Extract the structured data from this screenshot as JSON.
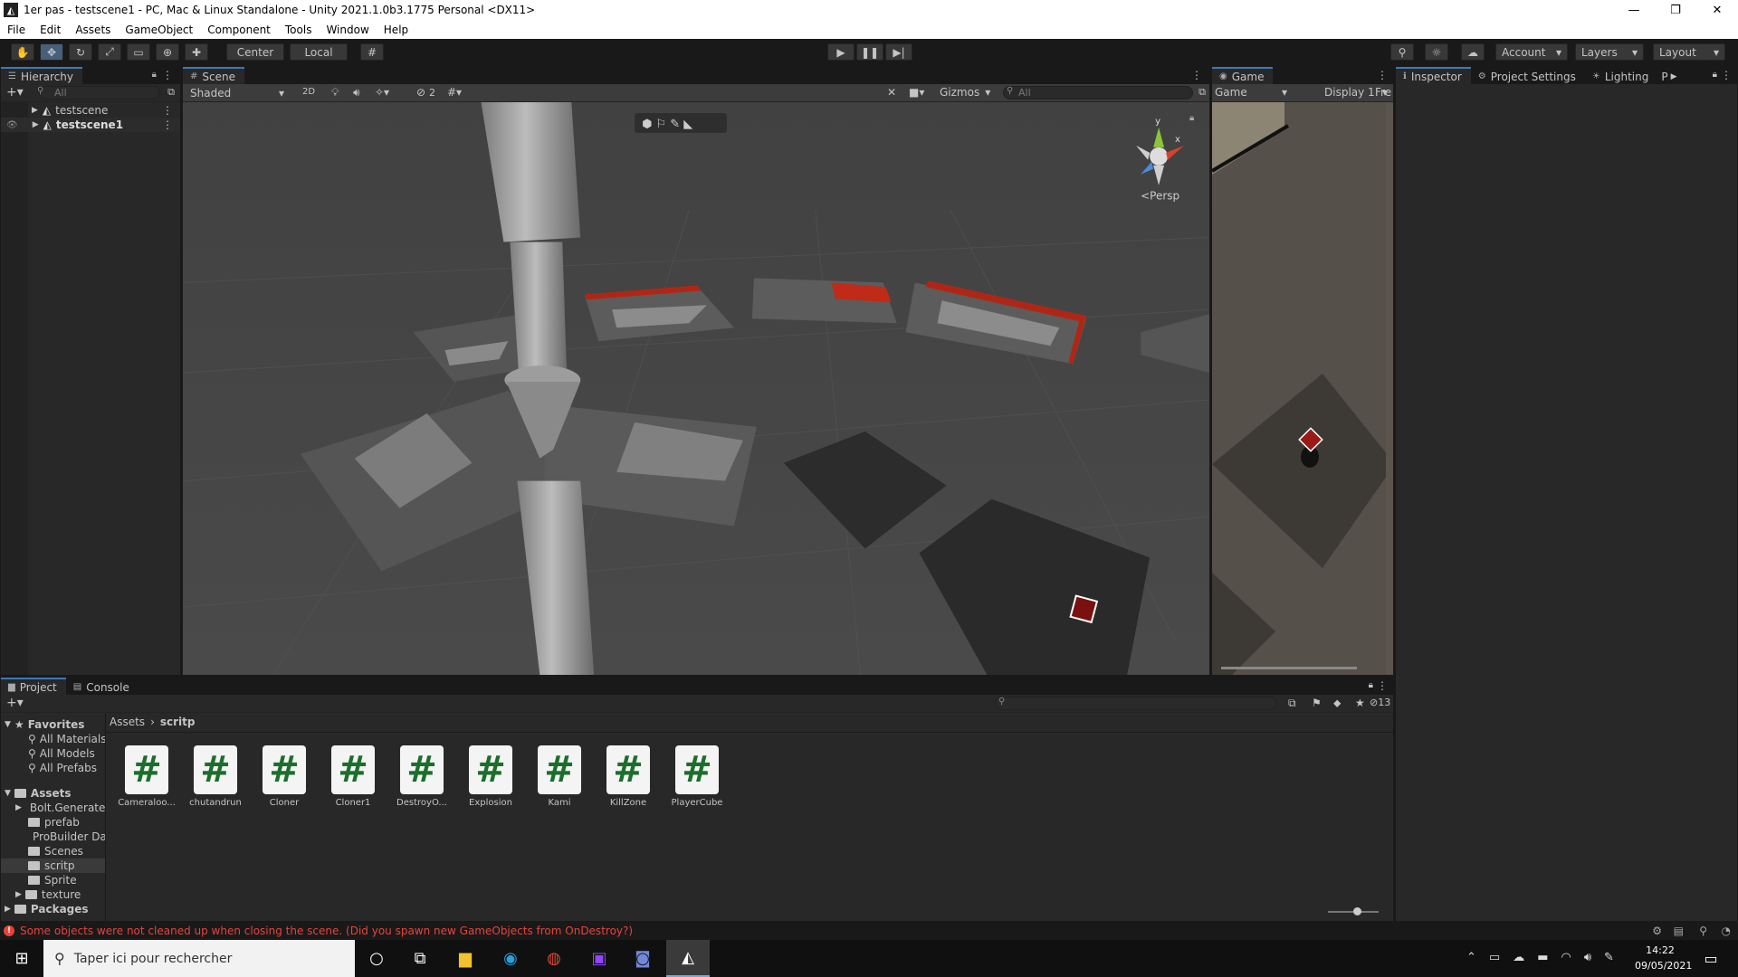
{
  "window": {
    "title": "1er pas - testscene1 - PC, Mac & Linux Standalone - Unity 2021.1.0b3.1775 Personal <DX11>",
    "controls": [
      "—",
      "❐",
      "✕"
    ]
  },
  "menu": [
    "File",
    "Edit",
    "Assets",
    "GameObject",
    "Component",
    "Tools",
    "Window",
    "Help"
  ],
  "toolbar": {
    "pivot": "Center",
    "space": "Local",
    "account": "Account",
    "layers": "Layers",
    "layout": "Layout"
  },
  "hierarchy": {
    "tab": "Hierarchy",
    "search_placeholder": "All",
    "items": [
      "testscene",
      "testscene1"
    ]
  },
  "scene": {
    "tab": "Scene",
    "shading": "Shaded",
    "mode_2d": "2D",
    "hidden_count": "2",
    "gizmos": "Gizmos",
    "search_placeholder": "All",
    "gizmo_axis_y": "y",
    "gizmo_axis_x": "x",
    "projection": "Persp"
  },
  "game": {
    "tab": "Game",
    "mode": "Game",
    "display": "Display 1",
    "aspect": "Fre"
  },
  "inspector": {
    "tabs": [
      "Inspector",
      "Project Settings",
      "Lighting"
    ],
    "more": "P"
  },
  "project": {
    "tabs": [
      "Project",
      "Console"
    ],
    "hidden_count": "13",
    "breadcrumb": [
      "Assets",
      "scritp"
    ],
    "favorites_label": "Favorites",
    "favorites": [
      "All Materials",
      "All Models",
      "All Prefabs"
    ],
    "assets_label": "Assets",
    "folders": [
      "Bolt.Generated",
      "prefab",
      "ProBuilder Data",
      "Scenes",
      "scritp",
      "Sprite",
      "texture"
    ],
    "packages_label": "Packages",
    "scripts": [
      "Cameraloo...",
      "chutandrun",
      "Cloner",
      "Cloner1",
      "DestroyO...",
      "Explosion",
      "Kami",
      "KillZone",
      "PlayerCube"
    ]
  },
  "status": {
    "message": "Some objects were not cleaned up when closing the scene. (Did you spawn new GameObjects from OnDestroy?)"
  },
  "taskbar": {
    "search_placeholder": "Taper ici pour rechercher",
    "time": "14:22",
    "date": "09/05/2021"
  },
  "colors": {
    "accent": "#3a79bb",
    "error": "#e8433a",
    "editor_bg": "#282828"
  }
}
